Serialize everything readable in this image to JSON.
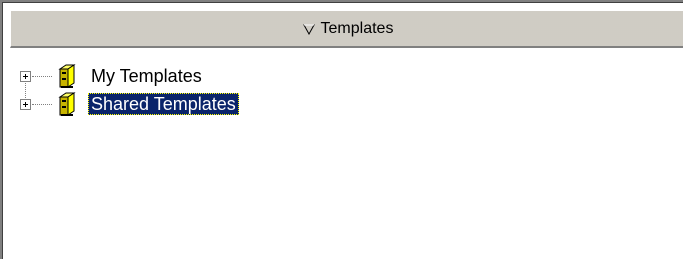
{
  "header": {
    "title": "Templates",
    "sort_icon": "sort-descending-triangle"
  },
  "tree": {
    "items": [
      {
        "label": "My Templates",
        "icon": "template-book-icon",
        "expanded": false,
        "selected": false
      },
      {
        "label": "Shared Templates",
        "icon": "template-book-icon",
        "expanded": false,
        "selected": true
      }
    ]
  },
  "colors": {
    "selection": "#0a246a",
    "header_bg": "#d4d0c8"
  }
}
